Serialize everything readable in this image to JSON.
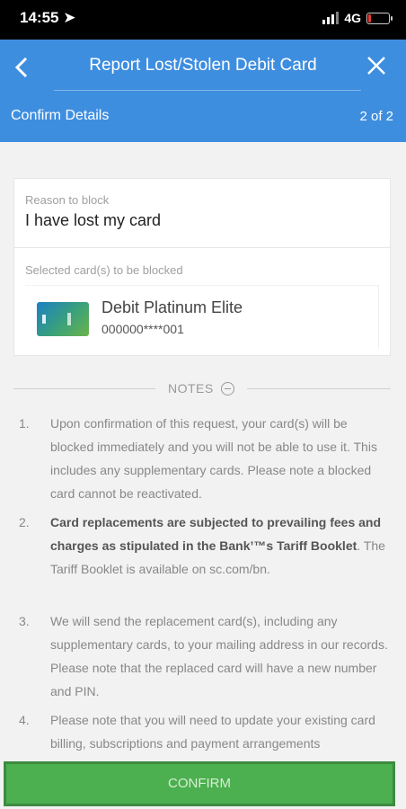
{
  "status_bar": {
    "time": "14:55 ➤",
    "network": "4G"
  },
  "header": {
    "back_icon": "chevron-left-icon",
    "title": "Report Lost/Stolen Debit Card",
    "close_icon": "close-icon",
    "subtitle": "Confirm Details",
    "step": "2 of 2"
  },
  "details": {
    "reason_label": "Reason to block",
    "reason_value": "I have lost my card",
    "cards_label": "Selected card(s) to be blocked",
    "card": {
      "name": "Debit Platinum Elite",
      "number": "000000****001"
    }
  },
  "notes": {
    "title": "NOTES",
    "items": [
      {
        "num": "1.",
        "text": "Upon confirmation of this request, your card(s) will be blocked immediately and you will not be able to use it. This includes any supplementary cards. Please note a blocked card cannot be reactivated."
      },
      {
        "num": "2.",
        "bold": "Card replacements are subjected to prevailing fees and charges as stipulated in the Bank’™s Tariff Booklet",
        "text": ". The Tariff Booklet is available on sc.com/bn."
      },
      {
        "num": "3.",
        "text": "We will send the replacement card(s), including any supplementary cards, to your mailing address in our records. Please note that the replaced card will have a new number and PIN."
      },
      {
        "num": "4.",
        "text": "Please note that you will need to update your existing card billing, subscriptions and payment arrangements"
      }
    ]
  },
  "confirm_label": "CONFIRM",
  "colors": {
    "header": "#3e8ee0",
    "confirm": "#4caf50"
  }
}
